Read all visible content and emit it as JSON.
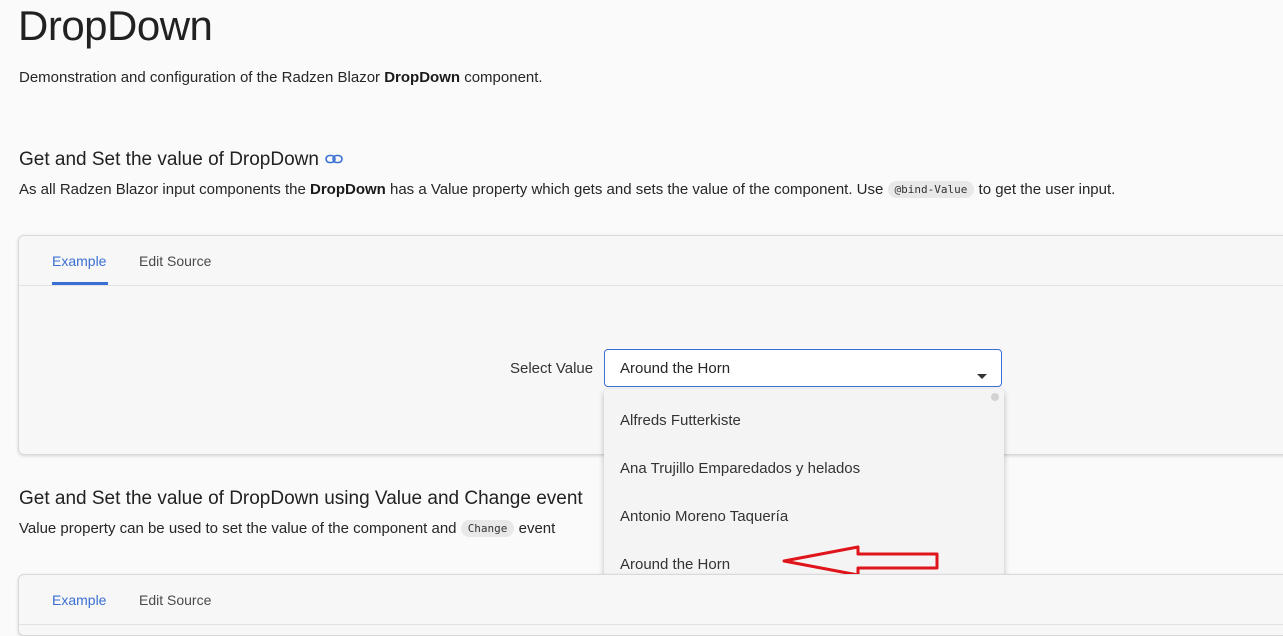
{
  "page": {
    "title": "DropDown",
    "intro_prefix": "Demonstration and configuration of the Radzen Blazor ",
    "intro_bold": "DropDown",
    "intro_suffix": " component."
  },
  "section1": {
    "title": "Get and Set the value of DropDown",
    "desc_prefix": "As all Radzen Blazor input components the ",
    "desc_bold": "DropDown",
    "desc_middle": " has a Value property which gets and sets the value of the component. Use ",
    "desc_code": "@bind-Value",
    "desc_suffix": " to get the user input.",
    "tabs": {
      "example": "Example",
      "edit_source": "Edit Source"
    },
    "field_label": "Select Value",
    "dropdown_value": "Around the Horn",
    "options": [
      "Alfreds Futterkiste",
      "Ana Trujillo Emparedados y helados",
      "Antonio Moreno Taquería",
      "Around the Horn"
    ]
  },
  "section2": {
    "title": "Get and Set the value of DropDown using Value and Change event",
    "desc_prefix": "Value property can be used to set the value of the component and ",
    "desc_code": "Change",
    "desc_suffix": " event",
    "tabs": {
      "example": "Example",
      "edit_source": "Edit Source"
    }
  },
  "colors": {
    "accent": "#3a6fd3",
    "annotation_arrow": "#e0141b"
  },
  "icons": {
    "anchor": "link-icon",
    "caret": "caret-down-icon",
    "annotation": "red-arrow-annotation"
  }
}
